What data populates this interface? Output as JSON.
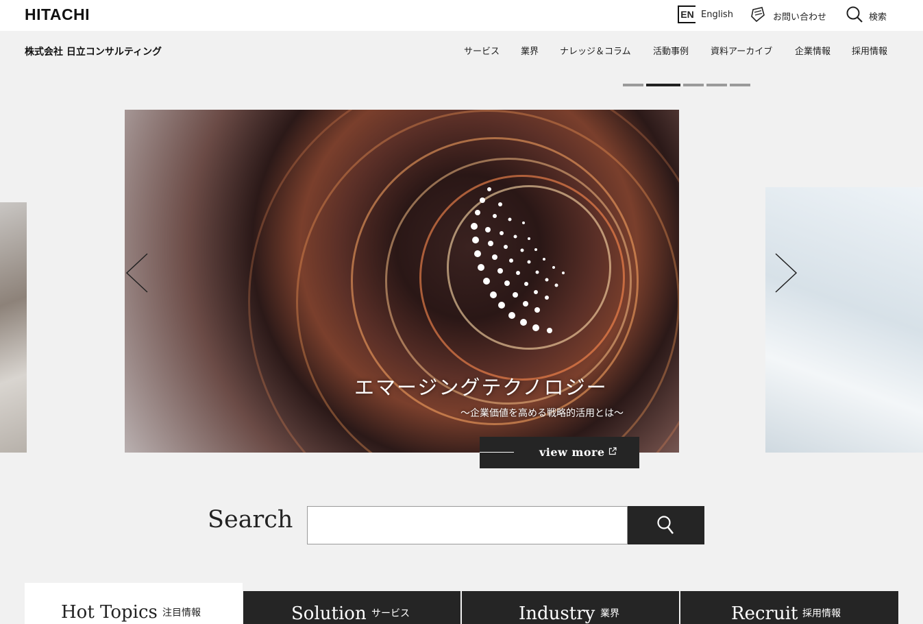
{
  "header": {
    "logo": "HITACHI",
    "english_badge": "EN",
    "english_label": "English",
    "contact_label": "お問い合わせ",
    "search_label": "検索"
  },
  "subheader": {
    "company": "株式会社 日立コンサルティング",
    "nav": [
      "サービス",
      "業界",
      "ナレッジ＆コラム",
      "活動事例",
      "資料アーカイブ",
      "企業情報",
      "採用情報"
    ]
  },
  "carousel": {
    "slide_count": 5,
    "active_index": 1,
    "title": "エマージングテクノロジー",
    "subtitle": "～企業価値を高める戦略的活用とは～",
    "view_more": "view more"
  },
  "search": {
    "label": "Search",
    "placeholder": ""
  },
  "tabs": [
    {
      "en": "Hot Topics",
      "ja": "注目情報"
    },
    {
      "en": "Solution",
      "ja": "サービス"
    },
    {
      "en": "Industry",
      "ja": "業界"
    },
    {
      "en": "Recruit",
      "ja": "採用情報"
    }
  ],
  "colors": {
    "dark": "#252525",
    "background": "#f1f1f1"
  }
}
